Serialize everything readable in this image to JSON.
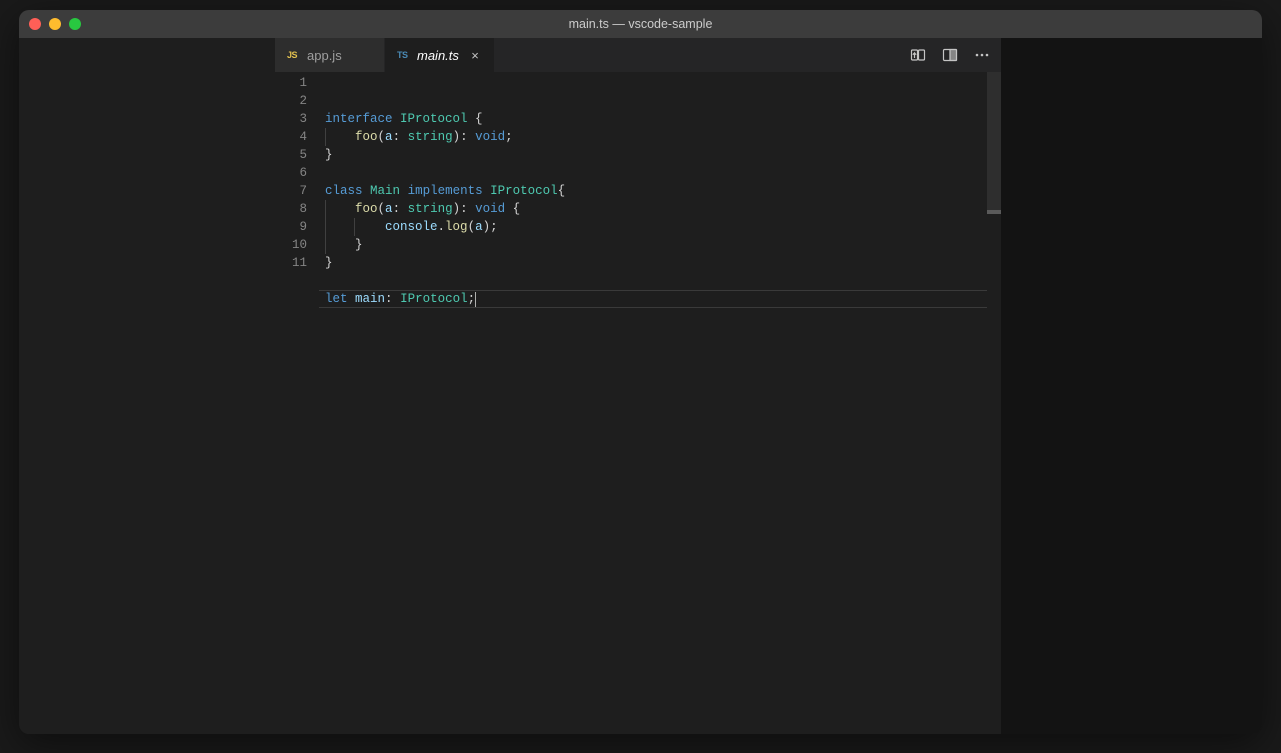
{
  "window": {
    "title": "main.ts — vscode-sample"
  },
  "tabs": [
    {
      "icon": "JS",
      "iconClass": "js",
      "label": "app.js",
      "active": false,
      "italic": false,
      "closeVisible": false,
      "name": "tab-app-js"
    },
    {
      "icon": "TS",
      "iconClass": "ts",
      "label": "main.ts",
      "active": true,
      "italic": true,
      "closeVisible": true,
      "name": "tab-main-ts"
    }
  ],
  "editor": {
    "lineCount": 11,
    "currentLine": 11,
    "code": [
      [
        {
          "t": "interface",
          "c": "kw-blue"
        },
        {
          "t": " "
        },
        {
          "t": "IProtocol",
          "c": "kw-type"
        },
        {
          "t": " {",
          "c": "pn"
        }
      ],
      [
        {
          "t": "    "
        },
        {
          "t": "foo",
          "c": "kw-fn"
        },
        {
          "t": "(",
          "c": "pn"
        },
        {
          "t": "a",
          "c": "kw-var"
        },
        {
          "t": ": ",
          "c": "pn"
        },
        {
          "t": "string",
          "c": "kw-type"
        },
        {
          "t": "): ",
          "c": "pn"
        },
        {
          "t": "void",
          "c": "kw-str"
        },
        {
          "t": ";",
          "c": "pn"
        }
      ],
      [
        {
          "t": "}",
          "c": "pn"
        }
      ],
      [],
      [
        {
          "t": "class",
          "c": "kw-blue"
        },
        {
          "t": " "
        },
        {
          "t": "Main",
          "c": "kw-type"
        },
        {
          "t": " "
        },
        {
          "t": "implements",
          "c": "kw-blue"
        },
        {
          "t": " "
        },
        {
          "t": "IProtocol",
          "c": "kw-type"
        },
        {
          "t": "{",
          "c": "pn"
        }
      ],
      [
        {
          "t": "    "
        },
        {
          "t": "foo",
          "c": "kw-fn"
        },
        {
          "t": "(",
          "c": "pn"
        },
        {
          "t": "a",
          "c": "kw-var"
        },
        {
          "t": ": ",
          "c": "pn"
        },
        {
          "t": "string",
          "c": "kw-type"
        },
        {
          "t": "): ",
          "c": "pn"
        },
        {
          "t": "void",
          "c": "kw-str"
        },
        {
          "t": " {",
          "c": "pn"
        }
      ],
      [
        {
          "t": "        "
        },
        {
          "t": "console",
          "c": "kw-var"
        },
        {
          "t": ".",
          "c": "pn"
        },
        {
          "t": "log",
          "c": "kw-fn"
        },
        {
          "t": "(",
          "c": "pn"
        },
        {
          "t": "a",
          "c": "kw-var"
        },
        {
          "t": ");",
          "c": "pn"
        }
      ],
      [
        {
          "t": "    }",
          "c": "pn"
        }
      ],
      [
        {
          "t": "}",
          "c": "pn"
        }
      ],
      [],
      [
        {
          "t": "let",
          "c": "kw-blue"
        },
        {
          "t": " "
        },
        {
          "t": "main",
          "c": "kw-var"
        },
        {
          "t": ": ",
          "c": "pn"
        },
        {
          "t": "IProtocol",
          "c": "kw-type"
        },
        {
          "t": ";",
          "c": "pn"
        }
      ]
    ],
    "indentGuides": {
      "2": [
        0
      ],
      "6": [
        0
      ],
      "7": [
        0,
        1
      ],
      "8": [
        0
      ]
    }
  },
  "icons": {
    "open_changes": "open-changes-icon",
    "split": "split-editor-icon",
    "more": "more-icon"
  }
}
